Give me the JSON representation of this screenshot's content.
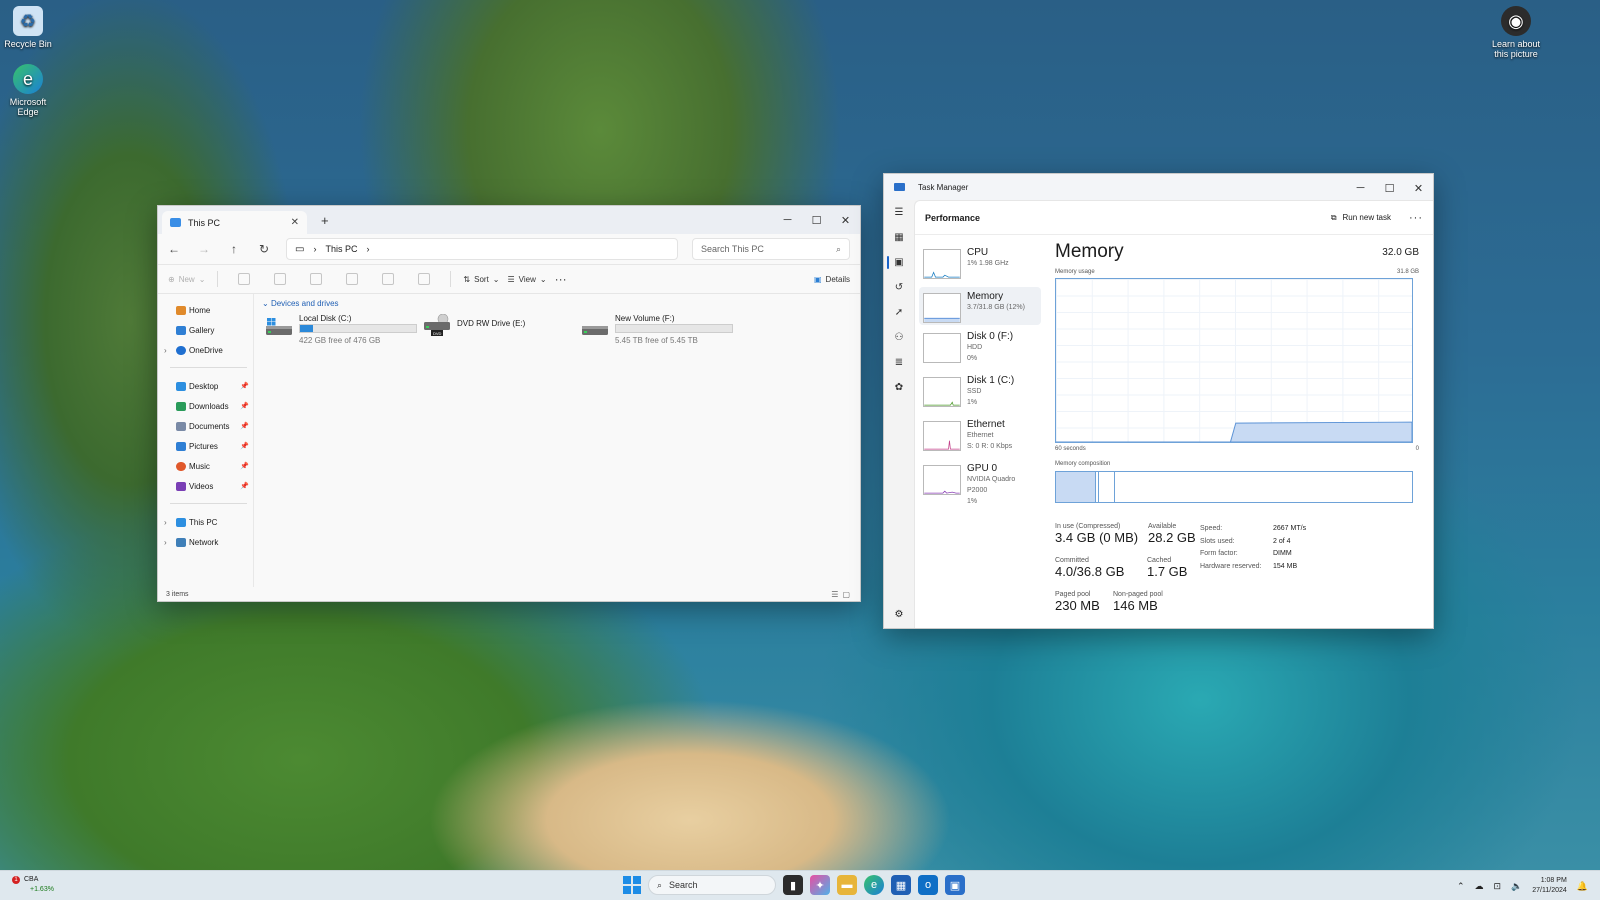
{
  "desktop": {
    "icons": [
      {
        "label": "Recycle Bin",
        "icon": "recycle-bin-icon"
      },
      {
        "label": "Microsoft Edge",
        "icon": "edge-icon"
      },
      {
        "label": "Learn about this picture",
        "icon": "camera-icon"
      }
    ]
  },
  "explorer": {
    "tab_title": "This PC",
    "path_root_icon": "monitor-icon",
    "path_label": "This PC",
    "search_placeholder": "Search This PC",
    "toolbar": {
      "new_label": "New",
      "sort_label": "Sort",
      "view_label": "View",
      "details_label": "Details"
    },
    "nav": {
      "top": [
        {
          "label": "Home",
          "color": "#e08a2b",
          "chevron": ""
        },
        {
          "label": "Gallery",
          "color": "#2f7fd4",
          "chevron": ""
        },
        {
          "label": "OneDrive",
          "color": "#1f6fd0",
          "chevron": "›"
        }
      ],
      "quick": [
        {
          "label": "Desktop",
          "color": "#2d8fe0"
        },
        {
          "label": "Downloads",
          "color": "#2a9b5a"
        },
        {
          "label": "Documents",
          "color": "#7a8aa6"
        },
        {
          "label": "Pictures",
          "color": "#2f7fd4"
        },
        {
          "label": "Music",
          "color": "#e0582b"
        },
        {
          "label": "Videos",
          "color": "#7a3fb5"
        }
      ],
      "bottom": [
        {
          "label": "This PC",
          "color": "#2d8fe0"
        },
        {
          "label": "Network",
          "color": "#3f7fb8"
        }
      ]
    },
    "group_header": "Devices and drives",
    "drives": [
      {
        "name": "Local Disk (C:)",
        "free": "422 GB free of 476 GB",
        "used_fraction": 0.11,
        "has_bar": true
      },
      {
        "name": "DVD RW Drive (E:)",
        "free": "",
        "used_fraction": 0,
        "has_bar": false
      },
      {
        "name": "New Volume (F:)",
        "free": "5.45 TB free of 5.45 TB",
        "used_fraction": 0.0,
        "has_bar": true
      }
    ],
    "dvd_badge": "DVD",
    "status": "3 items"
  },
  "taskmgr": {
    "title": "Task Manager",
    "section": "Performance",
    "run_new_task": "Run new task",
    "list": [
      {
        "name": "CPU",
        "sub1": "1% 1.98 GHz",
        "sub2": "",
        "sub3": "",
        "color": "#1a7fc4"
      },
      {
        "name": "Memory",
        "sub1": "3.7/31.8 GB (12%)",
        "sub2": "",
        "sub3": "",
        "color": "#3a7ad1"
      },
      {
        "name": "Disk 0 (F:)",
        "sub1": "HDD",
        "sub2": "0%",
        "sub3": "",
        "color": "#4c9a2a"
      },
      {
        "name": "Disk 1 (C:)",
        "sub1": "SSD",
        "sub2": "1%",
        "sub3": "",
        "color": "#4c9a2a"
      },
      {
        "name": "Ethernet",
        "sub1": "Ethernet",
        "sub2": "S: 0 R: 0 Kbps",
        "sub3": "",
        "color": "#c3418a"
      },
      {
        "name": "GPU 0",
        "sub1": "NVIDIA Quadro P2000",
        "sub2": "1%",
        "sub3": "",
        "color": "#8a3fb5"
      }
    ],
    "detail": {
      "heading": "Memory",
      "total": "32.0 GB",
      "usage_label": "Memory usage",
      "usage_max": "31.8 GB",
      "time_left": "60 seconds",
      "time_right": "0",
      "composition_label": "Memory composition",
      "usage_fraction": 0.116,
      "stats": [
        {
          "k": "In use (Compressed)",
          "v": "3.4 GB (0 MB)"
        },
        {
          "k": "Available",
          "v": "28.2 GB"
        },
        {
          "k": "Committed",
          "v": "4.0/36.8 GB"
        },
        {
          "k": "Cached",
          "v": "1.7 GB"
        },
        {
          "k": "Paged pool",
          "v": "230 MB"
        },
        {
          "k": "Non-paged pool",
          "v": "146 MB"
        }
      ],
      "specs": [
        {
          "k": "Speed:",
          "v": "2667 MT/s"
        },
        {
          "k": "Slots used:",
          "v": "2 of 4"
        },
        {
          "k": "Form factor:",
          "v": "DIMM"
        },
        {
          "k": "Hardware reserved:",
          "v": "154 MB"
        }
      ]
    }
  },
  "taskbar": {
    "widget_name": "CBA",
    "widget_change": "+1.63%",
    "widget_badge": "1",
    "search_label": "Search",
    "clock_time": "1:08 PM",
    "clock_date": "27/11/2024"
  }
}
